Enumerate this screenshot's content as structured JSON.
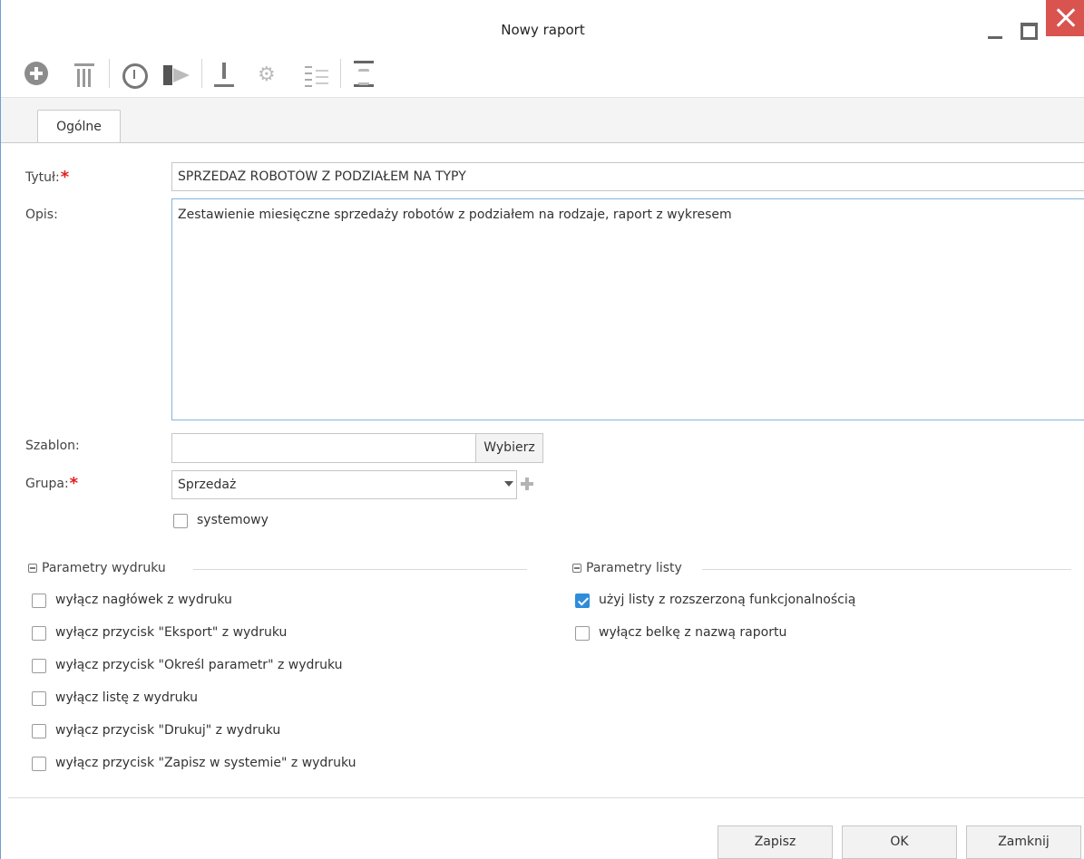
{
  "window": {
    "title": "Nowy raport"
  },
  "toolbar": {
    "icons": [
      "add-circle-icon",
      "trash-icon",
      "alarm-clock-icon",
      "megaphone-icon",
      "download-icon",
      "gears-icon",
      "list-icon",
      "hourglass-icon"
    ]
  },
  "tabs": [
    {
      "label": "Ogólne",
      "active": true
    }
  ],
  "form": {
    "title_label": "Tytuł:",
    "title_value": "SPRZEDAŻ ROBOTÓW Z PODZIAŁEM NA TYPY",
    "desc_label": "Opis:",
    "desc_value": "Zestawienie miesięczne sprzedaży robotów z podziałem na rodzaje, raport z wykresem",
    "template_label": "Szablon:",
    "template_value": "",
    "choose_button": "Wybierz",
    "group_label": "Grupa:",
    "group_value": "Sprzedaż",
    "system_label": "systemowy",
    "required_mark": "*"
  },
  "print_params": {
    "title": "Parametry wydruku",
    "options": [
      {
        "label": "wyłącz nagłówek z wydruku",
        "checked": false
      },
      {
        "label": "wyłącz przycisk \"Eksport\" z wydruku",
        "checked": false
      },
      {
        "label": "wyłącz przycisk \"Określ parametr\" z wydruku",
        "checked": false
      },
      {
        "label": "wyłącz listę z wydruku",
        "checked": false
      },
      {
        "label": "wyłącz przycisk \"Drukuj\" z wydruku",
        "checked": false
      },
      {
        "label": "wyłącz przycisk \"Zapisz w systemie\" z wydruku",
        "checked": false
      }
    ]
  },
  "list_params": {
    "title": "Parametry listy",
    "options": [
      {
        "label": "użyj listy z rozszerzoną funkcjonalnością",
        "checked": true
      },
      {
        "label": "wyłącz belkę z nazwą raportu",
        "checked": false
      }
    ]
  },
  "footer": {
    "save": "Zapisz",
    "ok": "OK",
    "close": "Zamknij"
  },
  "colors": {
    "accent": "#2e8dd9",
    "close_button": "#d9534f",
    "required": "#e02020"
  }
}
